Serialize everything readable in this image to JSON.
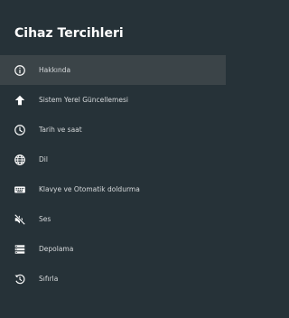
{
  "header": {
    "title": "Cihaz Tercihleri"
  },
  "menu": {
    "selected_index": 0,
    "items": [
      {
        "label": "Hakkında",
        "icon": "info-icon"
      },
      {
        "label": "Sistem Yerel Güncellemesi",
        "icon": "arrow-up-icon"
      },
      {
        "label": "Tarih ve saat",
        "icon": "clock-icon"
      },
      {
        "label": "Dil",
        "icon": "globe-icon"
      },
      {
        "label": "Klavye ve Otomatik doldurma",
        "icon": "keyboard-icon"
      },
      {
        "label": "Ses",
        "icon": "volume-off-icon"
      },
      {
        "label": "Depolama",
        "icon": "storage-icon"
      },
      {
        "label": "Sıfırla",
        "icon": "reset-icon"
      }
    ]
  },
  "colors": {
    "background": "#263238",
    "selected_background": "#3b4448",
    "title_text": "#ffffff",
    "item_text": "#d6d9db",
    "icon": "#ffffff"
  }
}
